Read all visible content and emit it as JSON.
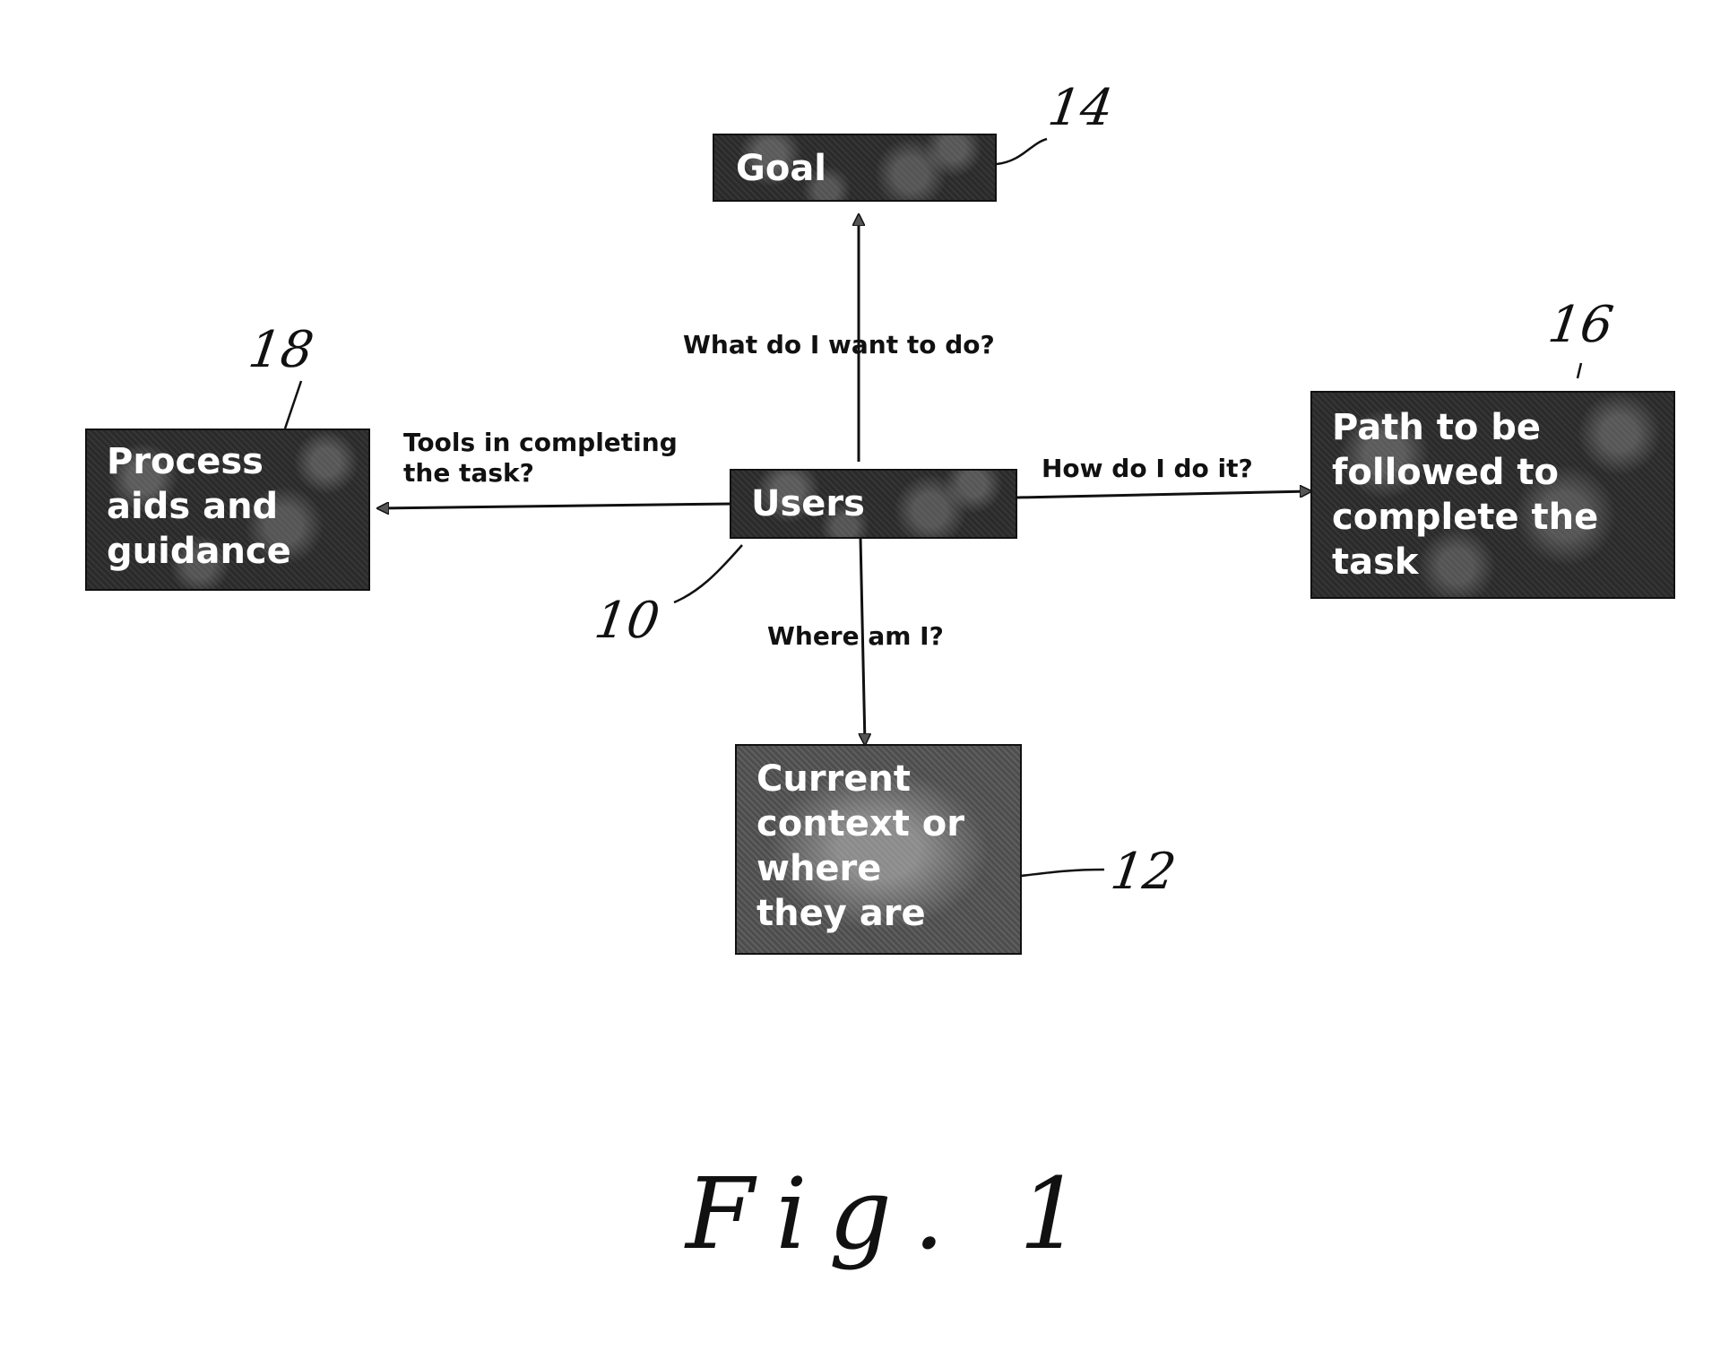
{
  "figure": {
    "caption": "Fig. 1"
  },
  "nodes": {
    "users": {
      "label": "Users",
      "ref": "10"
    },
    "goal": {
      "label": "Goal",
      "ref": "14"
    },
    "context": {
      "label": "Current\ncontext or\nwhere\nthey are",
      "ref": "12"
    },
    "path": {
      "label": "Path to be\nfollowed to\ncomplete the\ntask",
      "ref": "16"
    },
    "process": {
      "label": "Process\naids and\nguidance",
      "ref": "18"
    }
  },
  "edges": {
    "to_goal": {
      "label": "What do I want to do?"
    },
    "to_context": {
      "label": "Where am I?"
    },
    "to_path": {
      "label": "How do I do it?"
    },
    "to_process": {
      "label": "Tools in completing\nthe task?"
    }
  },
  "colors": {
    "node_fill": "#2a2a2a",
    "node_text": "#ffffff",
    "line": "#111111",
    "background": "#ffffff"
  }
}
